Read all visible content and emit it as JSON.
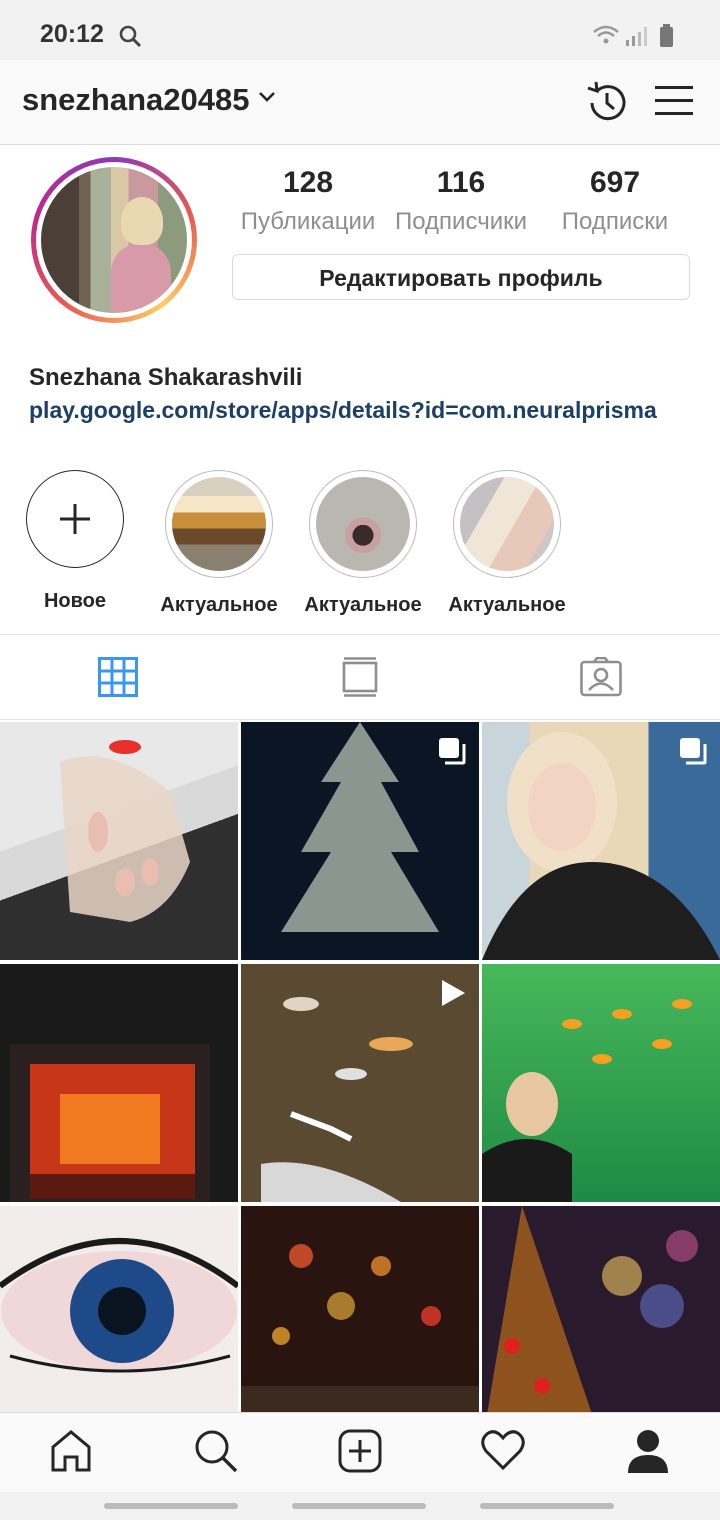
{
  "status_bar": {
    "time": "20:12"
  },
  "header": {
    "username": "snezhana20485"
  },
  "profile": {
    "stats": [
      {
        "value": "128",
        "label": "Публикации"
      },
      {
        "value": "116",
        "label": "Подписчики"
      },
      {
        "value": "697",
        "label": "Подписки"
      }
    ],
    "edit_button": "Редактировать профиль",
    "full_name": "Snezhana Shakarashvili",
    "link": "play.google.com/store/apps/details?id=com.neuralprisma"
  },
  "highlights": [
    {
      "label": "Новое",
      "icon": "plus-icon"
    },
    {
      "label": "Актуальное"
    },
    {
      "label": "Актуальное"
    },
    {
      "label": "Актуальное"
    }
  ],
  "tabs": [
    {
      "icon": "grid-icon",
      "active": true
    },
    {
      "icon": "feed-icon",
      "active": false
    },
    {
      "icon": "tagged-icon",
      "active": false
    }
  ],
  "grid_posts": [
    {
      "subject": "red nails",
      "badge": ""
    },
    {
      "subject": "christmas tree lights",
      "badge": "multiple-icon"
    },
    {
      "subject": "selfie",
      "badge": "multiple-icon"
    },
    {
      "subject": "fireplace",
      "badge": ""
    },
    {
      "subject": "koi fish",
      "badge": "video-icon"
    },
    {
      "subject": "aquarium",
      "badge": ""
    },
    {
      "subject": "eye art",
      "badge": ""
    },
    {
      "subject": "city lights",
      "badge": ""
    },
    {
      "subject": "christmas tree bokeh",
      "badge": ""
    }
  ],
  "bottom_nav": [
    "home-icon",
    "search-icon",
    "add-post-icon",
    "activity-heart-icon",
    "profile-icon"
  ],
  "colors": {
    "accent_blue": "#3897f0",
    "link": "#1b3f66",
    "secondary_text": "#8e8e8e"
  }
}
